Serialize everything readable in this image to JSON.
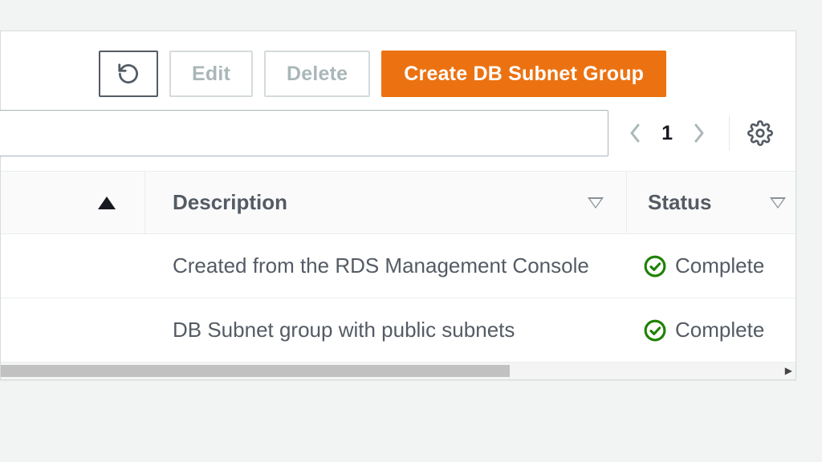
{
  "toolbar": {
    "edit_label": "Edit",
    "delete_label": "Delete",
    "create_label": "Create DB Subnet Group"
  },
  "pagination": {
    "current": "1"
  },
  "columns": {
    "description": "Description",
    "status": "Status"
  },
  "rows": [
    {
      "description": "Created from the RDS Management Console",
      "status": "Complete"
    },
    {
      "description": "DB Subnet group with public subnets",
      "status": "Complete"
    }
  ],
  "colors": {
    "primary": "#ec7211",
    "success": "#1d8102"
  }
}
